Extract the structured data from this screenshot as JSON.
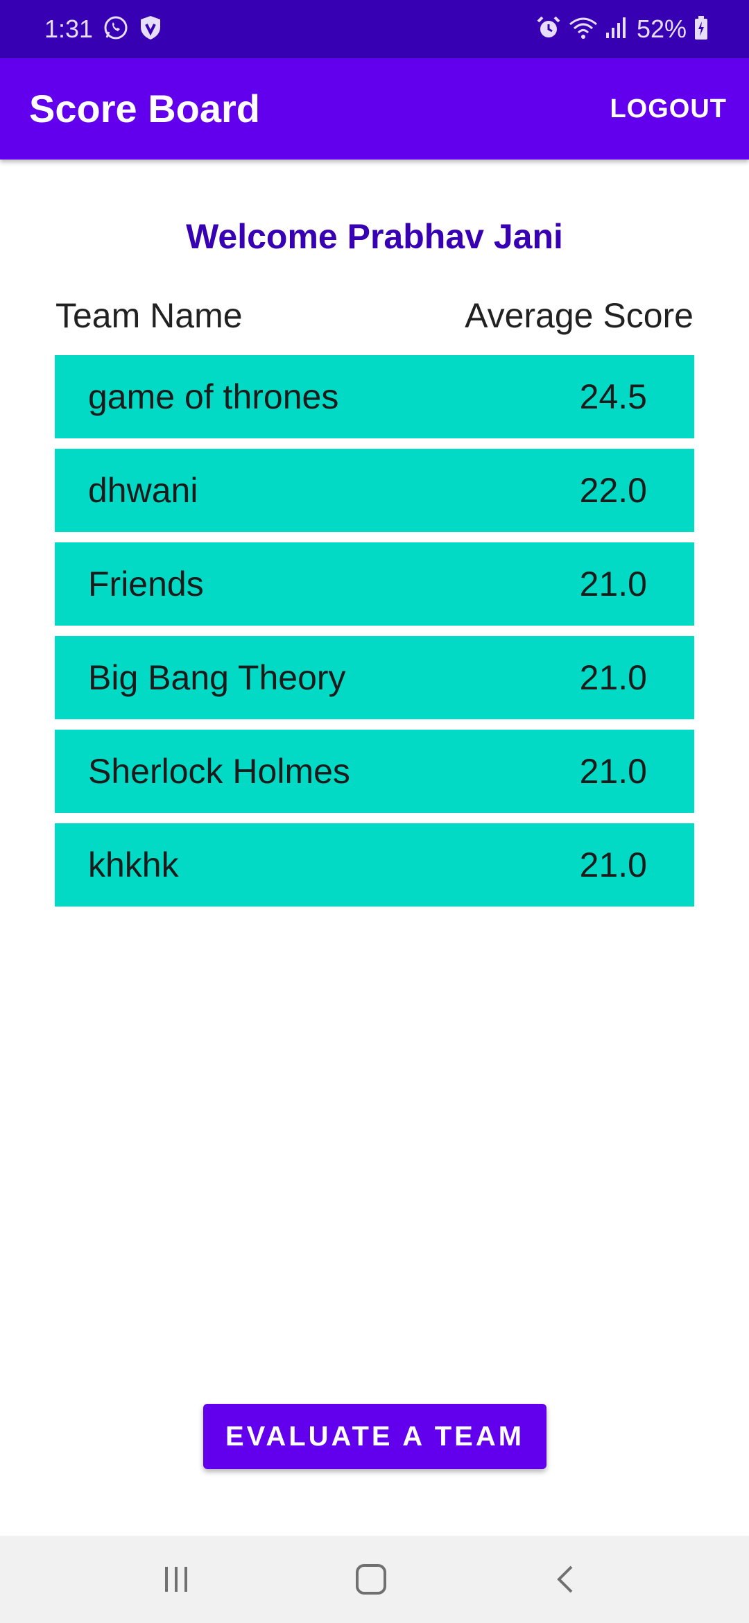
{
  "status_bar": {
    "time": "1:31",
    "battery": "52%",
    "icons": [
      "whatsapp-icon",
      "shield-icon",
      "alarm-icon",
      "wifi-icon",
      "signal-icon",
      "battery-icon"
    ]
  },
  "app_bar": {
    "title": "Score Board",
    "logout_label": "LOGOUT"
  },
  "welcome": "Welcome Prabhav Jani",
  "table": {
    "headers": {
      "team_name": "Team Name",
      "average_score": "Average Score"
    },
    "rows": [
      {
        "name": "game of thrones",
        "score": "24.5"
      },
      {
        "name": "dhwani",
        "score": "22.0"
      },
      {
        "name": "Friends",
        "score": "21.0"
      },
      {
        "name": "Big Bang Theory",
        "score": "21.0"
      },
      {
        "name": "Sherlock Holmes",
        "score": "21.0"
      },
      {
        "name": "khkhk",
        "score": "21.0"
      }
    ]
  },
  "evaluate_button": "EVALUATE A TEAM",
  "nav_bar": {
    "icons": [
      "recent-apps-icon",
      "home-icon",
      "back-icon"
    ]
  },
  "colors": {
    "status_bar": "#3700b3",
    "primary": "#6200ee",
    "accent": "#03dac5",
    "welcome_text": "#3700b3"
  }
}
